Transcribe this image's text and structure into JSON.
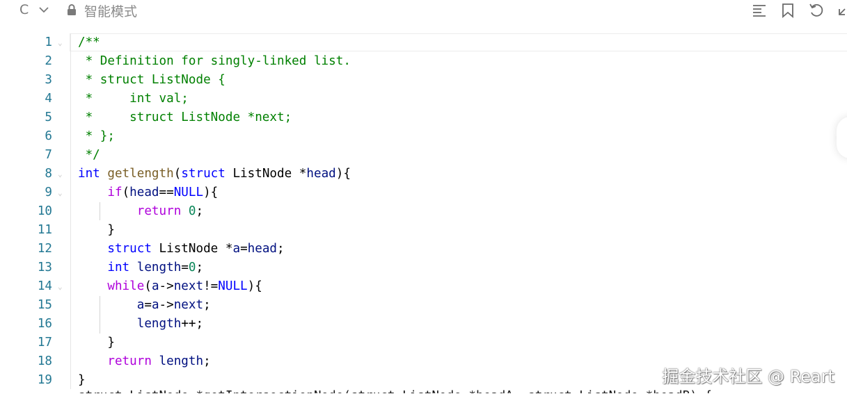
{
  "toolbar": {
    "language": "C",
    "mode_label": "智能模式"
  },
  "lines": [
    {
      "n": "1",
      "parts": [
        [
          "c",
          "/**"
        ]
      ]
    },
    {
      "n": "2",
      "parts": [
        [
          "c",
          " * Definition for singly-linked list."
        ]
      ]
    },
    {
      "n": "3",
      "parts": [
        [
          "c",
          " * struct ListNode {"
        ]
      ]
    },
    {
      "n": "4",
      "parts": [
        [
          "c",
          " *     int val;"
        ]
      ]
    },
    {
      "n": "5",
      "parts": [
        [
          "c",
          " *     struct ListNode *next;"
        ]
      ]
    },
    {
      "n": "6",
      "parts": [
        [
          "c",
          " * };"
        ]
      ]
    },
    {
      "n": "7",
      "parts": [
        [
          "c",
          " */"
        ]
      ]
    },
    {
      "n": "8",
      "parts": [
        [
          "k",
          "int"
        ],
        [
          "",
          " "
        ],
        [
          "f",
          "getlength"
        ],
        [
          "",
          "("
        ],
        [
          "k",
          "struct"
        ],
        [
          "",
          " ListNode *"
        ],
        [
          "v",
          "head"
        ],
        [
          "",
          "){"
        ]
      ]
    },
    {
      "n": "9",
      "parts": [
        [
          "",
          "    "
        ],
        [
          "ctl",
          "if"
        ],
        [
          "",
          "("
        ],
        [
          "v",
          "head"
        ],
        [
          "",
          "=="
        ],
        [
          "k",
          "NULL"
        ],
        [
          "",
          "){"
        ]
      ]
    },
    {
      "n": "10",
      "parts": [
        [
          "",
          "        "
        ],
        [
          "ctl",
          "return"
        ],
        [
          "",
          " "
        ],
        [
          "n",
          "0"
        ],
        [
          "",
          ";"
        ]
      ]
    },
    {
      "n": "11",
      "parts": [
        [
          "",
          "    }"
        ]
      ]
    },
    {
      "n": "12",
      "parts": [
        [
          "",
          "    "
        ],
        [
          "k",
          "struct"
        ],
        [
          "",
          " ListNode *"
        ],
        [
          "v",
          "a"
        ],
        [
          "",
          "="
        ],
        [
          "v",
          "head"
        ],
        [
          "",
          ";"
        ]
      ]
    },
    {
      "n": "13",
      "parts": [
        [
          "",
          "    "
        ],
        [
          "k",
          "int"
        ],
        [
          "",
          " "
        ],
        [
          "v",
          "length"
        ],
        [
          "",
          "="
        ],
        [
          "n",
          "0"
        ],
        [
          "",
          ";"
        ]
      ]
    },
    {
      "n": "14",
      "parts": [
        [
          "",
          "    "
        ],
        [
          "ctl",
          "while"
        ],
        [
          "",
          "("
        ],
        [
          "v",
          "a"
        ],
        [
          "",
          "->"
        ],
        [
          "v",
          "next"
        ],
        [
          "",
          "!="
        ],
        [
          "k",
          "NULL"
        ],
        [
          "",
          "){"
        ]
      ]
    },
    {
      "n": "15",
      "parts": [
        [
          "",
          "        "
        ],
        [
          "v",
          "a"
        ],
        [
          "",
          "="
        ],
        [
          "v",
          "a"
        ],
        [
          "",
          "->"
        ],
        [
          "v",
          "next"
        ],
        [
          "",
          ";"
        ]
      ]
    },
    {
      "n": "16",
      "parts": [
        [
          "",
          "        "
        ],
        [
          "v",
          "length"
        ],
        [
          "",
          "++;"
        ]
      ]
    },
    {
      "n": "17",
      "parts": [
        [
          "",
          "    }"
        ]
      ]
    },
    {
      "n": "18",
      "parts": [
        [
          "",
          "    "
        ],
        [
          "ctl",
          "return"
        ],
        [
          "",
          " "
        ],
        [
          "v",
          "length"
        ],
        [
          "",
          ";"
        ]
      ]
    },
    {
      "n": "19",
      "parts": [
        [
          "",
          "}"
        ]
      ]
    }
  ],
  "watermark": "掘金技术社区 @ Reart",
  "colors": {
    "comment": "#008000",
    "keyword": "#0000ff",
    "function": "#795e26",
    "control": "#af00db",
    "variable": "#001080",
    "number": "#098658",
    "line_number": "#237893"
  }
}
